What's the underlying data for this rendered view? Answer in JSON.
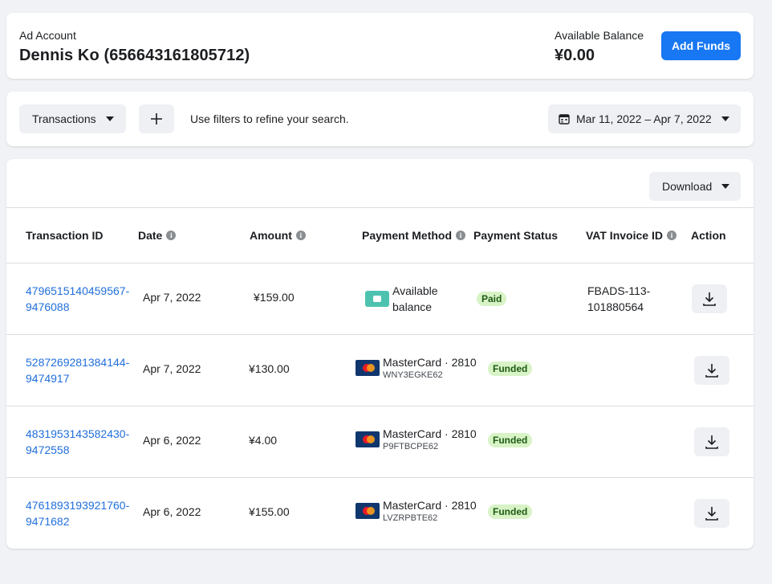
{
  "account": {
    "label": "Ad Account",
    "name": "Dennis Ko (656643161805712)",
    "balance_label": "Available Balance",
    "balance_value": "¥0.00",
    "add_funds_label": "Add Funds"
  },
  "filters": {
    "type_label": "Transactions",
    "hint": "Use filters to refine your search.",
    "date_range": "Mar 11, 2022 – Apr 7, 2022"
  },
  "table": {
    "download_label": "Download",
    "headers": {
      "transaction_id": "Transaction ID",
      "date": "Date",
      "amount": "Amount",
      "payment_method": "Payment Method",
      "payment_status": "Payment Status",
      "vat_invoice_id": "VAT Invoice ID",
      "action": "Action"
    },
    "rows": [
      {
        "txid_1": "4796515140459567-",
        "txid_2": "9476088",
        "date": "Apr 7, 2022",
        "amount": "¥159.00",
        "method_1": "Available",
        "method_2": "balance",
        "status": "Paid",
        "vat_1": "FBADS-113-",
        "vat_2": "101880564"
      },
      {
        "txid_1": "5287269281384144-",
        "txid_2": "9474917",
        "date": "Apr 7, 2022",
        "amount": "¥130.00",
        "card": "MasterCard · 2810",
        "ref": "WNY3EGKE62",
        "status": "Funded"
      },
      {
        "txid_1": "4831953143582430-",
        "txid_2": "9472558",
        "date": "Apr 6, 2022",
        "amount": "¥4.00",
        "card": "MasterCard · 2810",
        "ref": "P9FTBCPE62",
        "status": "Funded"
      },
      {
        "txid_1": "4761893193921760-",
        "txid_2": "9471682",
        "date": "Apr 6, 2022",
        "amount": "¥155.00",
        "card": "MasterCard · 2810",
        "ref": "LVZRPBTE62",
        "status": "Funded"
      }
    ]
  },
  "colors": {
    "primary": "#1877f2",
    "link": "#216fdb",
    "badge_bg": "#d8f3c6",
    "wallet": "#4ec2b0"
  }
}
